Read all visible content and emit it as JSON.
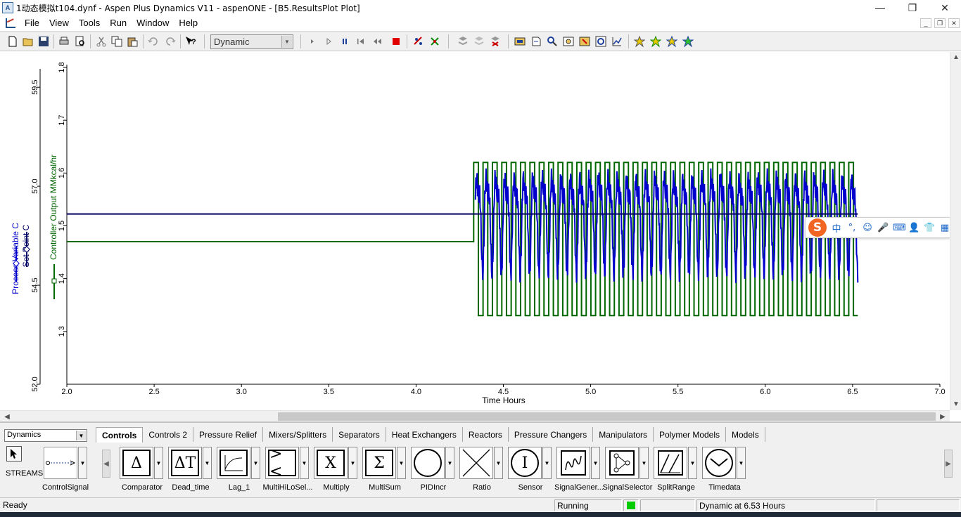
{
  "window": {
    "title": "1动态模拟t104.dynf - Aspen Plus Dynamics V11 - aspenONE - [B5.ResultsPlot Plot]",
    "app_icon_text": "A",
    "minimize": "—",
    "restore": "❐",
    "close": "✕"
  },
  "menu": {
    "items": [
      "File",
      "View",
      "Tools",
      "Run",
      "Window",
      "Help"
    ],
    "mdi_controls": [
      "_",
      "❐",
      "✕"
    ]
  },
  "toolbar": {
    "run_mode": "Dynamic",
    "icons": [
      "new-file-icon",
      "open-folder-icon",
      "save-icon",
      "print-icon",
      "print-preview-icon",
      "cut-icon",
      "copy-icon",
      "paste-icon",
      "undo-icon",
      "redo-icon",
      "whats-this-help-icon",
      "step-icon",
      "run-icon",
      "pause-icon",
      "rewind-icon",
      "restart-icon",
      "stop-icon",
      "snapshot-icon",
      "take-snapshot-icon",
      "model-library-icon",
      "variable-find-icon",
      "specification-icon",
      "explorer-icon",
      "flowsheet-icon",
      "plot-icon",
      "table-icon",
      "history-icon",
      "estimation-icon",
      "optimization-icon",
      "homotopy-icon",
      "diagnostics-icon"
    ]
  },
  "plot": {
    "x_axis_title": "Time Hours",
    "left_axis_pv_label": "Process Variable C",
    "left_axis_sp_label": "Set Point C",
    "right_axis_label": "Controller Output MMkcal/hr",
    "pv_color": "#0000cc",
    "sp_color": "#000066",
    "op_color": "#006600"
  },
  "chart_data": {
    "type": "line",
    "title": "",
    "xlabel": "Time Hours",
    "xlim": [
      2.0,
      7.0
    ],
    "x_ticks": [
      "2.0",
      "2.5",
      "3.0",
      "3.5",
      "4.0",
      "4.5",
      "5.0",
      "5.5",
      "6.0",
      "6.5",
      "7.0"
    ],
    "left_axis": {
      "label": "Process Variable C / Set Point C",
      "ylim": [
        52.0,
        60.0
      ],
      "ticks": [
        "52.0",
        "54.5",
        "57.0",
        "59.5"
      ]
    },
    "right_axis": {
      "label": "Controller Output MMkcal/hr",
      "ylim": [
        1.2,
        1.8
      ],
      "ticks": [
        "1.3",
        "1.4",
        "1.5",
        "1.6",
        "1.7",
        "1.8"
      ]
    },
    "series": [
      {
        "name": "Set Point C",
        "axis": "left",
        "color": "#000066",
        "x": [
          2.0,
          6.53
        ],
        "values": [
          56.3,
          56.3
        ]
      },
      {
        "name": "Controller Output MMkcal/hr",
        "axis": "right",
        "color": "#006600",
        "steady_value": 1.47,
        "start_oscillation": 4.33,
        "end": 6.53,
        "high": 1.62,
        "low": 1.33,
        "period": 0.0537
      },
      {
        "name": "Process Variable C",
        "axis": "right",
        "color": "#0000cc",
        "start_oscillation": 4.34,
        "end": 6.53,
        "center": 1.52,
        "amplitude": 0.11,
        "period": 0.0537
      }
    ]
  },
  "ime": {
    "logo": "S",
    "buttons": [
      "中",
      "°,",
      "☺",
      "🎤",
      "⌨",
      "👤",
      "👕",
      "▦"
    ]
  },
  "palette": {
    "category": "Dynamics",
    "tabs": [
      "Controls",
      "Controls 2",
      "Pressure Relief",
      "Mixers/Splitters",
      "Separators",
      "Heat Exchangers",
      "Reactors",
      "Pressure Changers",
      "Manipulators",
      "Polymer Models",
      "Models"
    ],
    "active_tab": "Controls",
    "streams_label": "STREAMS",
    "control_signal_label": "ControlSignal",
    "blocks": [
      {
        "label": "Comparator",
        "glyph": "Δ"
      },
      {
        "label": "Dead_time",
        "glyph": "ΔT"
      },
      {
        "label": "Lag_1",
        "glyph": ""
      },
      {
        "label": "MultiHiLoSel...",
        "glyph": "><"
      },
      {
        "label": "Multiply",
        "glyph": "X"
      },
      {
        "label": "MultiSum",
        "glyph": "Σ"
      },
      {
        "label": "PIDIncr",
        "glyph": ""
      },
      {
        "label": "Ratio",
        "glyph": ""
      },
      {
        "label": "Sensor",
        "glyph": "I"
      },
      {
        "label": "SignalGener...",
        "glyph": ""
      },
      {
        "label": "SignalSelector",
        "glyph": ""
      },
      {
        "label": "SplitRange",
        "glyph": ""
      },
      {
        "label": "Timedata",
        "glyph": ""
      }
    ]
  },
  "status": {
    "left": "Ready",
    "run_state": "Running",
    "indicator_color": "#00cc00",
    "time_text": "Dynamic at 6.53 Hours"
  }
}
